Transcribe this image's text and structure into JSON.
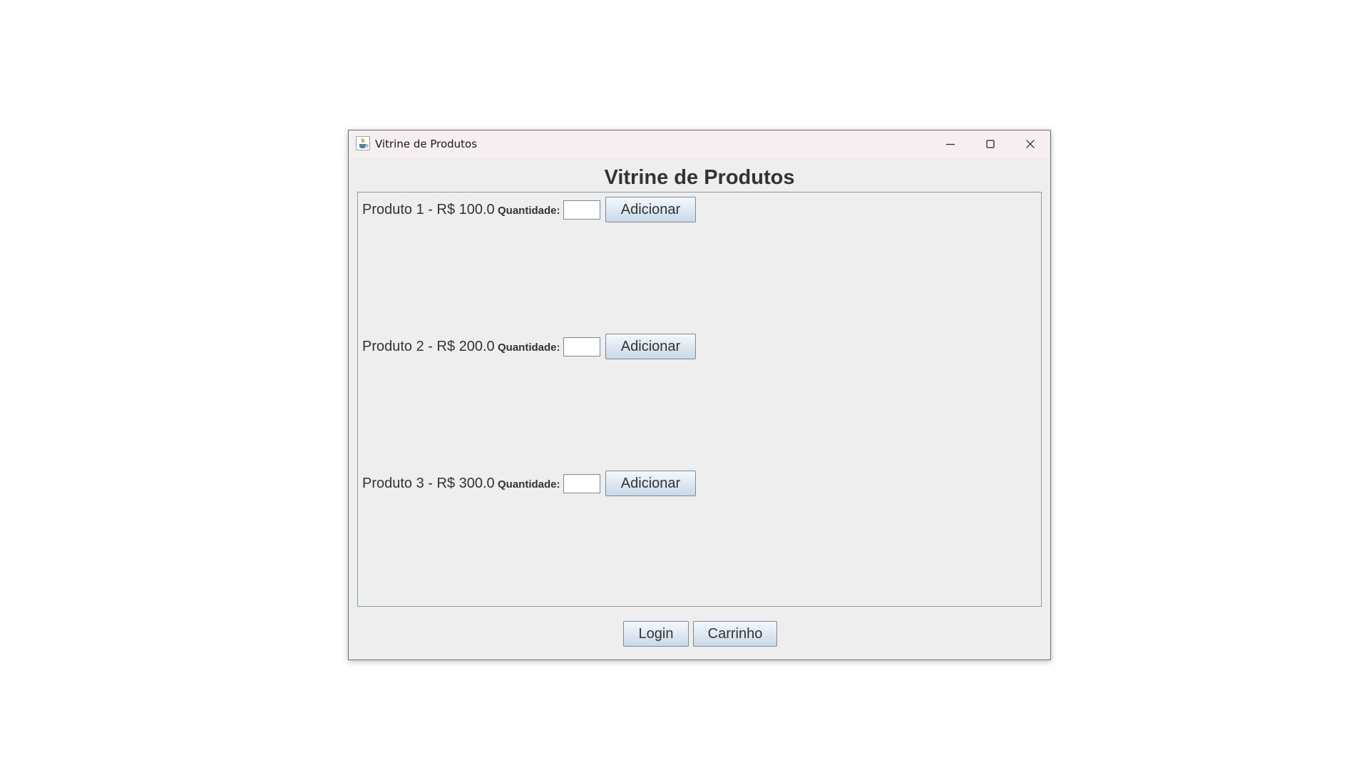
{
  "window": {
    "title": "Vitrine de Produtos",
    "icon": "java-cup-icon",
    "controls": [
      "minimize-icon",
      "maximize-icon",
      "close-icon"
    ]
  },
  "heading": "Vitrine de Produtos",
  "products": [
    {
      "name": "Produto 1 - R$ 100.0",
      "quantity_label": "Quantidade:",
      "quantity_value": "",
      "add_label": "Adicionar"
    },
    {
      "name": "Produto 2 - R$ 200.0",
      "quantity_label": "Quantidade:",
      "quantity_value": "",
      "add_label": "Adicionar"
    },
    {
      "name": "Produto 3 - R$ 300.0",
      "quantity_label": "Quantidade:",
      "quantity_value": "",
      "add_label": "Adicionar"
    }
  ],
  "footer": {
    "login_label": "Login",
    "cart_label": "Carrinho"
  },
  "colors": {
    "titlebar": "#f7efef",
    "window_bg": "#eeeeee",
    "button_gradient_top": "#f4f8fc",
    "button_gradient_bottom": "#c9d8e8",
    "panel_border": "#8a9aab"
  }
}
